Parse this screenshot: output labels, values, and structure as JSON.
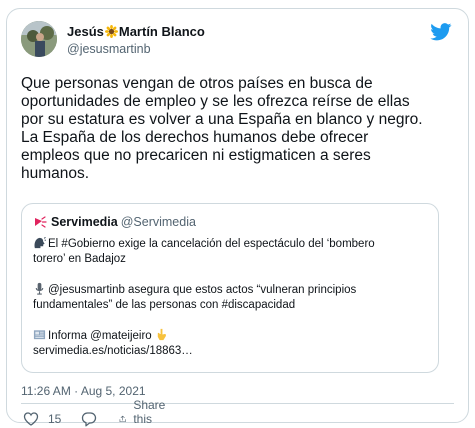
{
  "tweet": {
    "author": {
      "name_part1": "Jesús",
      "name_part2": "Martín Blanco",
      "handle": "@jesusmartinb",
      "emoji": "sunflower"
    },
    "text": "Que personas vengan de otros países en busca de\noportunidades de empleo y se les ofrezca reírse de ellas\npor su estatura es volver a una España en blanco y negro.\nLa España de los derechos humanos debe ofrecer\nempleos que no precaricen ni estigmaticen a seres\nhumanos.",
    "quoted": {
      "name": "Servimedia",
      "handle": "@Servimedia",
      "lines": [
        "El #Gobierno exige la cancelación del espectáculo del ‘bombero",
        "torero’ en Badajoz",
        "@jesusmartinb asegura que estos actos “vulneran principios",
        "fundamentales” de las personas con #discapacidad",
        "Informa @mateijeiro",
        "servimedia.es/noticias/18863…"
      ],
      "icons": [
        "speaking-head-icon",
        "microphone-icon",
        "newspaper-icon",
        "pointing-down-icon"
      ]
    },
    "timestamp": "11:26 AM · Aug 5, 2021",
    "like_count": "15",
    "share_label": "Share this Tweet"
  },
  "colors": {
    "twitter_blue": "#1d9bf0",
    "secondary_text": "#536471",
    "border": "#cfd9de",
    "primary_text": "#0f1419"
  }
}
